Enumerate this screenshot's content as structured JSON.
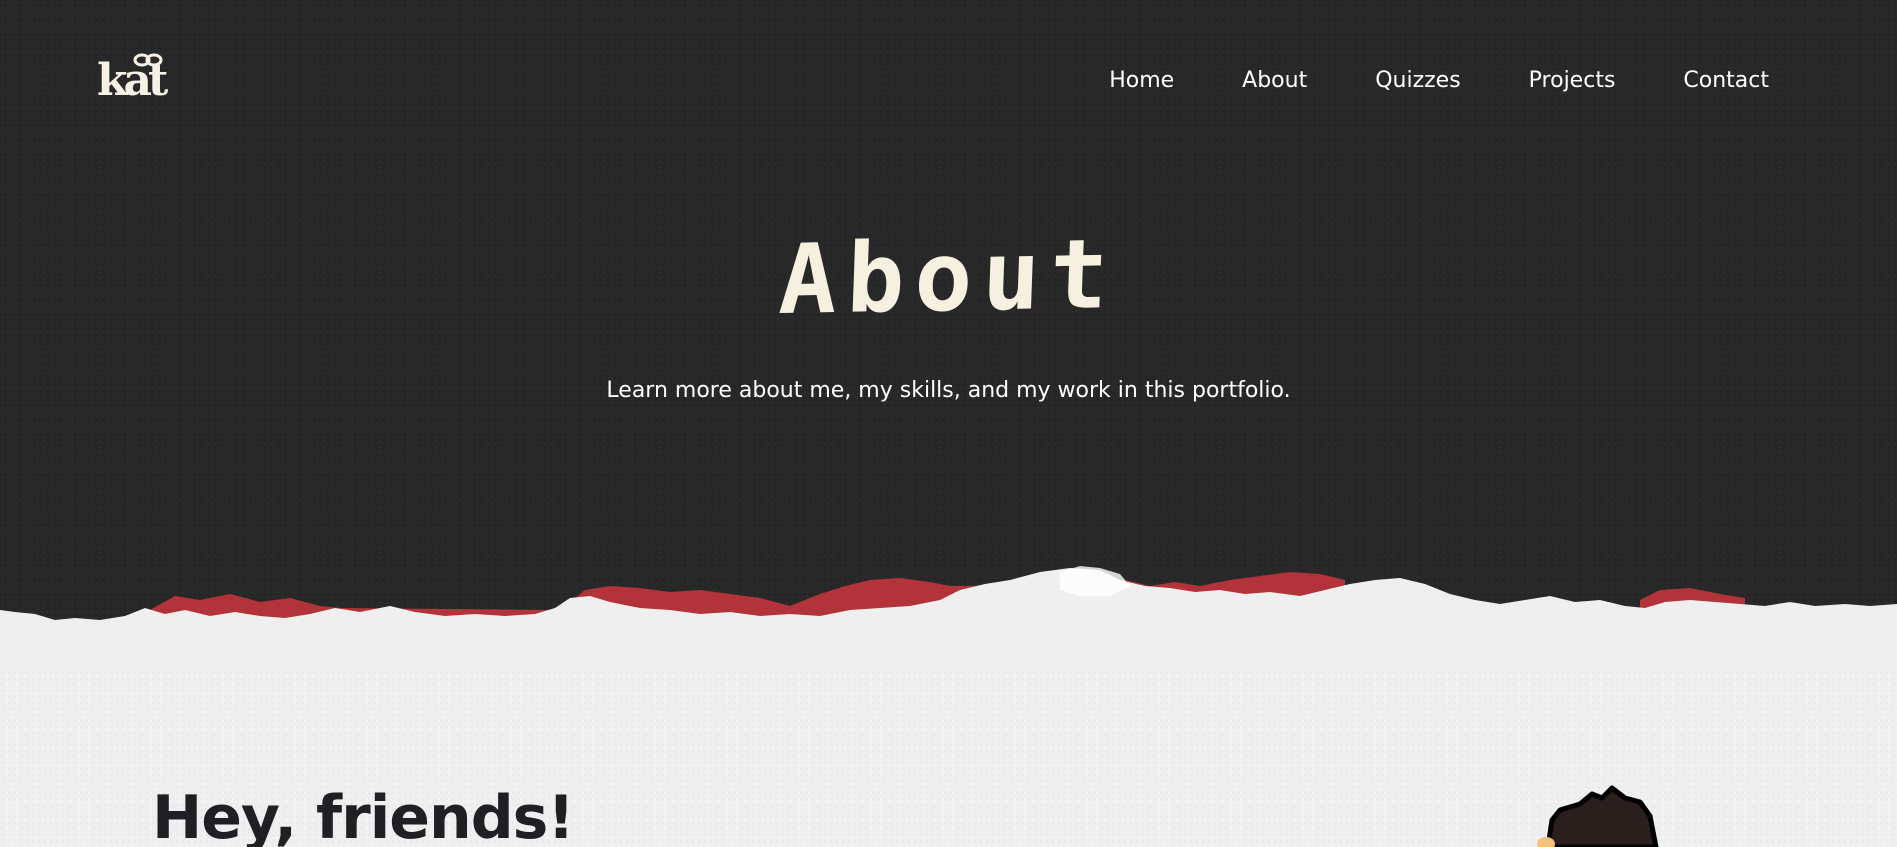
{
  "brand": {
    "logo_text": "kat"
  },
  "nav": {
    "items": [
      {
        "label": "Home"
      },
      {
        "label": "About"
      },
      {
        "label": "Quizzes"
      },
      {
        "label": "Projects"
      },
      {
        "label": "Contact"
      }
    ]
  },
  "hero": {
    "title": "About",
    "subtitle": "Learn more about me, my skills, and my work in this portfolio."
  },
  "intro": {
    "heading": "Hey, friends!"
  },
  "colors": {
    "hero_background": "#282828",
    "paper_background": "#efefef",
    "accent_red": "#b3333a",
    "title_cream": "#f5f0e0",
    "heading_dark": "#1f1f24"
  },
  "icons": {
    "logo_bow": "gift-bow-icon",
    "avatar": "avatar-illustration"
  }
}
